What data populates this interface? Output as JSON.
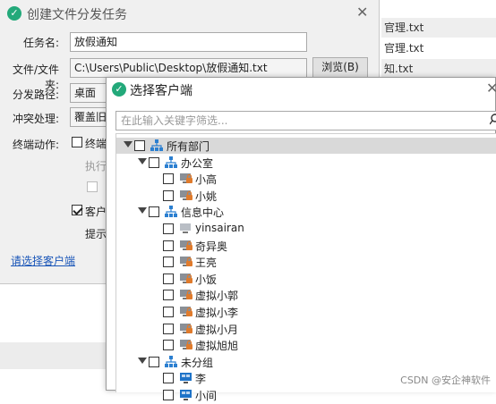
{
  "background": {
    "list_items": [
      "官理.txt",
      "官理.txt",
      "知.txt"
    ]
  },
  "task_dialog": {
    "title": "创建文件分发任务",
    "labels": {
      "task_name": "任务名:",
      "file": "文件/文件夹:",
      "path": "分发路径:",
      "conflict": "冲突处理:",
      "terminal_action": "终端动作:"
    },
    "task_name_value": "放假通知",
    "file_value": "C:\\Users\\Public\\Desktop\\放假通知.txt",
    "browse_label": "浏览(B)",
    "path_value": "桌面",
    "conflict_value": "覆盖旧文",
    "terminal_check_label": "终端",
    "exec_label": "执行",
    "client_check_label": "客户",
    "prompt_label": "提示",
    "select_clients_link": "请选择客户端"
  },
  "client_dialog": {
    "title": "选择客户端",
    "search_placeholder": "在此输入关键字筛选...",
    "tree": {
      "root": "所有部门",
      "groups": [
        {
          "name": "办公室",
          "clients": [
            {
              "name": "小高",
              "status": "locked"
            },
            {
              "name": "小姚",
              "status": "locked"
            }
          ]
        },
        {
          "name": "信息中心",
          "clients": [
            {
              "name": "yinsairan",
              "status": "online"
            },
            {
              "name": "奇异奥",
              "status": "locked"
            },
            {
              "name": "王亮",
              "status": "locked"
            },
            {
              "name": "小饭",
              "status": "locked"
            },
            {
              "name": "虚拟小郭",
              "status": "locked"
            },
            {
              "name": "虚拟小李",
              "status": "locked"
            },
            {
              "name": "虚拟小月",
              "status": "locked"
            },
            {
              "name": "虚拟旭旭",
              "status": "locked"
            }
          ]
        },
        {
          "name": "未分组",
          "clients": [
            {
              "name": "李",
              "status": "windows"
            },
            {
              "name": "小间",
              "status": "windows"
            }
          ]
        }
      ]
    }
  },
  "watermark": "CSDN @安企神软件",
  "colors": {
    "accent": "#23a97a",
    "org_icon": "#2b7fd0",
    "lock": "#e07b2c",
    "link": "#1a56b8"
  }
}
